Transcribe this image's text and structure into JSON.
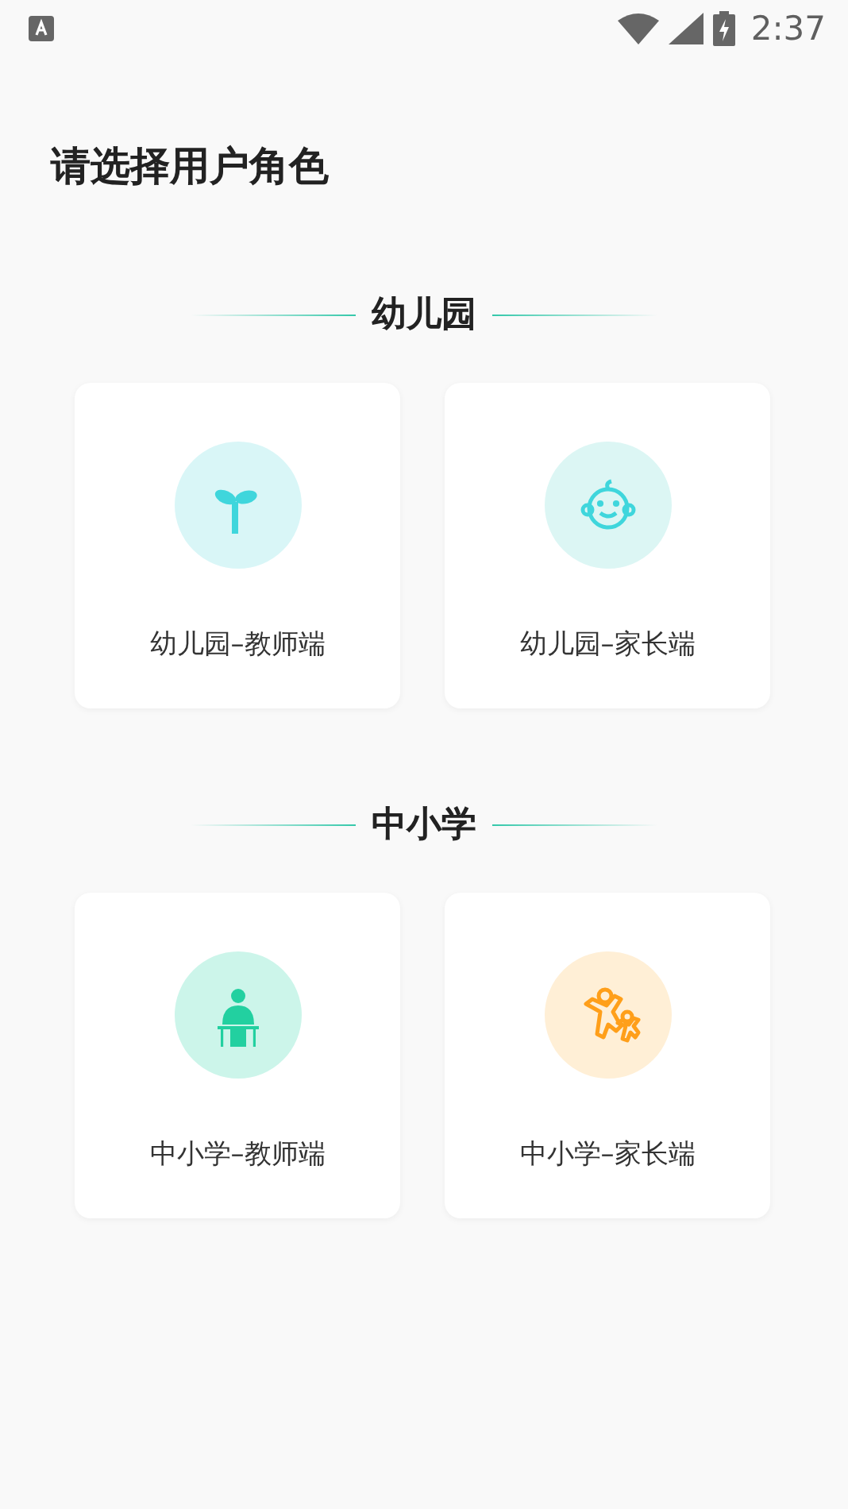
{
  "status_bar": {
    "time": "2:37"
  },
  "title": "请选择用户角色",
  "sections": [
    {
      "heading": "幼儿园",
      "roles": [
        {
          "label": "幼儿园–教师端",
          "kind": "sprout"
        },
        {
          "label": "幼儿园–家长端",
          "kind": "baby"
        }
      ]
    },
    {
      "heading": "中小学",
      "roles": [
        {
          "label": "中小学–教师端",
          "kind": "student"
        },
        {
          "label": "中小学–家长端",
          "kind": "family"
        }
      ]
    }
  ]
}
